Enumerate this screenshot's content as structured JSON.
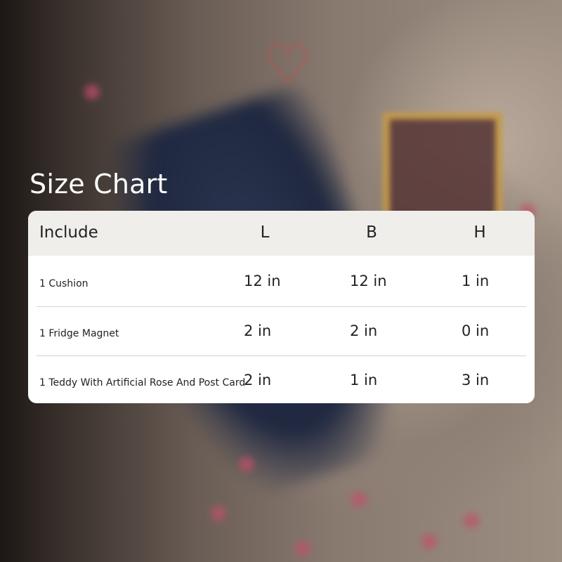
{
  "title": "Size Chart",
  "table": {
    "headers": [
      "Include",
      "L",
      "B",
      "H"
    ],
    "rows": [
      {
        "name": "1 Cushion",
        "l": "12 in",
        "b": "12 in",
        "h": "1 in"
      },
      {
        "name": "1 Fridge Magnet",
        "l": "2 in",
        "b": "2 in",
        "h": "0 in"
      },
      {
        "name": "1 Teddy With Artificial Rose And Post Card",
        "l": "2 in",
        "b": "1 in",
        "h": "3 in"
      }
    ]
  },
  "colors": {
    "header_bg": "#efeeeb",
    "card_bg": "#ffffff",
    "title_text": "#ffffff",
    "body_text": "#222222",
    "divider": "#d3d3d3"
  }
}
